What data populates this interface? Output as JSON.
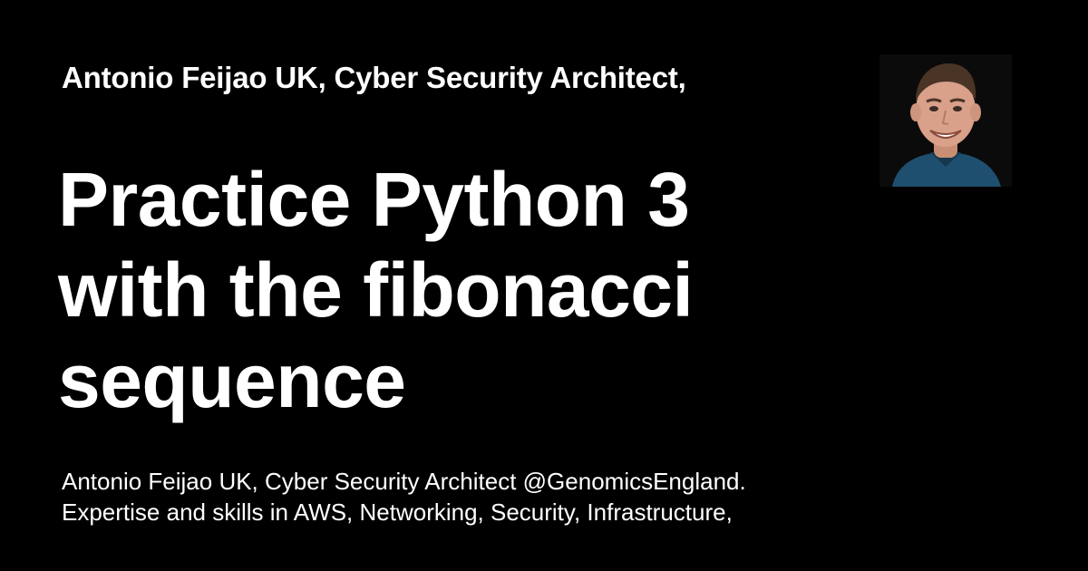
{
  "card": {
    "subtitle": "Antonio Feijao UK, Cyber Security Architect,",
    "title_lines": [
      "Practice Python 3",
      "with the fibonacci",
      "sequence"
    ],
    "description_lines": [
      "Antonio Feijao UK, Cyber Security Architect @GenomicsEngland.",
      "Expertise and skills in AWS, Networking, Security, Infrastructure,"
    ],
    "background_color": "#000000",
    "text_color": "#ffffff",
    "avatar": {
      "icon": "author-photo"
    }
  }
}
